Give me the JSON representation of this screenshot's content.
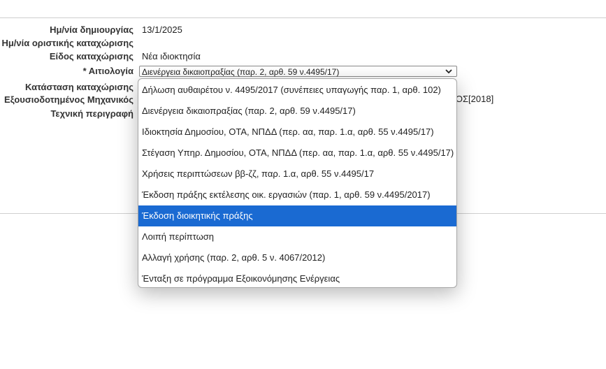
{
  "form": {
    "fields": [
      {
        "label": "Ημ/νία δημιουργίας",
        "value": "13/1/2025"
      },
      {
        "label": "Ημ/νία οριστικής καταχώρισης",
        "value": ""
      },
      {
        "label": "Είδος καταχώρισης",
        "value": "Νέα ιδιοκτησία"
      },
      {
        "label": "* Αιτιολογία",
        "value": ""
      },
      {
        "label": "Κατάσταση καταχώρισης",
        "value": ""
      },
      {
        "label": "Εξουσιοδοτημένος Μηχανικός",
        "value": "ΙΚΟΣ[2018]"
      },
      {
        "label": "Τεχνική περιγραφή",
        "value": ""
      }
    ]
  },
  "aitiologia_select": {
    "selected_value": "Διενέργεια δικαιοπραξίας (παρ. 2, αρθ. 59 ν.4495/17)",
    "options": [
      "Δήλωση αυθαιρέτου ν. 4495/2017 (συνέπειες υπαγωγής παρ. 1, αρθ. 102)",
      "Διενέργεια δικαιοπραξίας (παρ. 2, αρθ. 59 ν.4495/17)",
      "Ιδιοκτησία Δημοσίου, ΟΤΑ, ΝΠΔΔ (περ. αα, παρ. 1.α, αρθ. 55 ν.4495/17)",
      "Στέγαση Υπηρ. Δημοσίου, ΟΤΑ, ΝΠΔΔ (περ. αα, παρ. 1.α, αρθ. 55 ν.4495/17)",
      "Χρήσεις περιπτώσεων ββ-ζζ, παρ. 1.α, αρθ. 55 ν.4495/17",
      "Έκδοση πράξης εκτέλεσης οικ. εργασιών (παρ. 1, αρθ. 59 ν.4495/2017)",
      "Έκδοση διοικητικής πράξης",
      "Λοιπή περίπτωση",
      "Αλλαγή χρήσης (παρ. 2, αρθ. 5 ν. 4067/2012)",
      "Ένταξη σε πρόγραμμα Εξοικονόμησης Ενέργειας"
    ],
    "highlighted_index": 6,
    "highlight_color": "#1a6ad2",
    "arrow_icon": "chevron-down-icon"
  }
}
